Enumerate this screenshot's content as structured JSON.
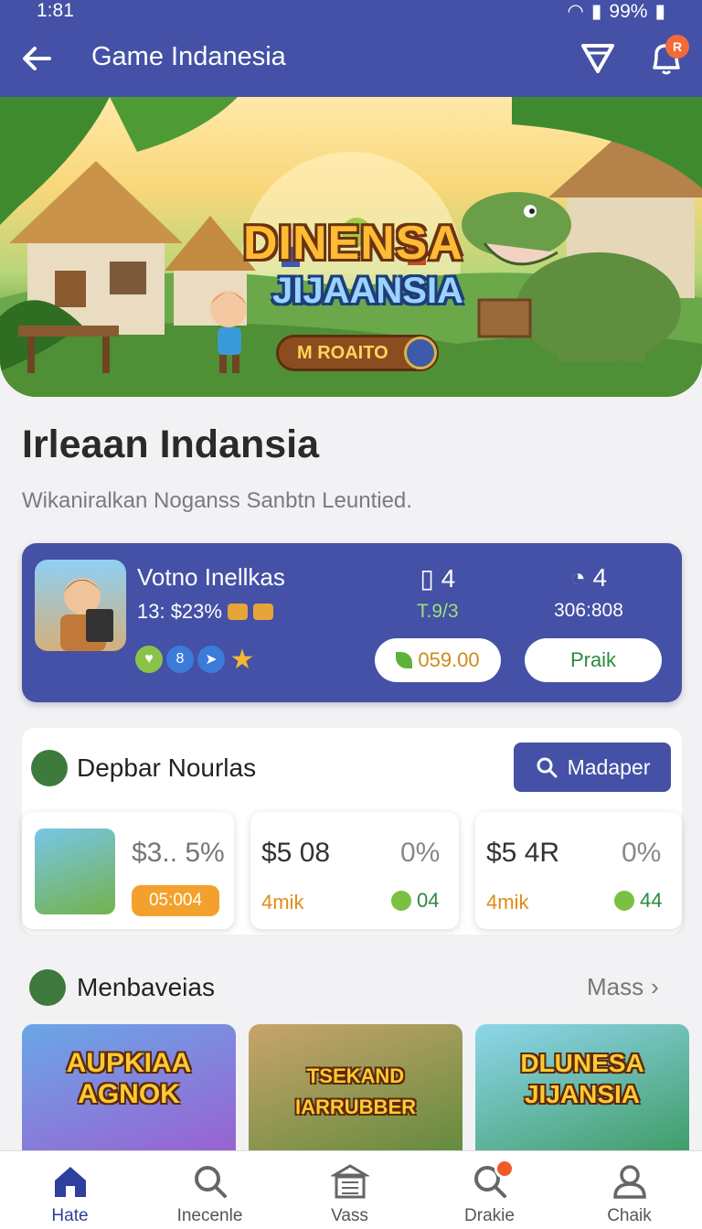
{
  "status": {
    "time": "1:81",
    "battery": "99%"
  },
  "appbar": {
    "title": "Game Indanesia",
    "notification_count": "R"
  },
  "banner": {
    "title_line1": "DINENSA",
    "title_line2": "JIJAANSIA",
    "button_label": "M ROAITO"
  },
  "page": {
    "title": "Irleaan Indansia",
    "subtitle": "Wikaniralkan Noganss Sanbtn Leuntied."
  },
  "profile": {
    "name": "Votno Inellkas",
    "stat": "13: $23%",
    "col1": {
      "value": "4",
      "sub": "T.9/3"
    },
    "col2": {
      "value": "4",
      "sub": "306:808"
    },
    "coins_label": "059.00",
    "play_label": "Praik"
  },
  "depbar": {
    "title": "Depbar Nourlas",
    "search_label": "Madaper",
    "cards": [
      {
        "value": "$3.. 5%",
        "badge": "05:004"
      },
      {
        "value": "$5 08",
        "percent": "0%",
        "label": "4mik",
        "count": "04"
      },
      {
        "value": "$5 4R",
        "percent": "0%",
        "label": "4mik",
        "count": "44"
      }
    ]
  },
  "members": {
    "title": "Menbaveias",
    "more_label": "Mass",
    "tiles": [
      {
        "text": "AUPKIAA AGNOK"
      },
      {
        "text": "TSEKAND IARRUBBER"
      },
      {
        "text": "DLUNESA JIJANSIA"
      }
    ]
  },
  "nav": [
    {
      "label": "Hate",
      "icon": "home-icon",
      "active": true
    },
    {
      "label": "Inecenle",
      "icon": "search-icon"
    },
    {
      "label": "Vass",
      "icon": "building-icon"
    },
    {
      "label": "Drakie",
      "icon": "search-alert-icon"
    },
    {
      "label": "Chaik",
      "icon": "profile-icon"
    }
  ],
  "colors": {
    "primary": "#4451a6",
    "accent": "#f26a3a",
    "green": "#2b8a3e",
    "orange": "#e28b18"
  }
}
